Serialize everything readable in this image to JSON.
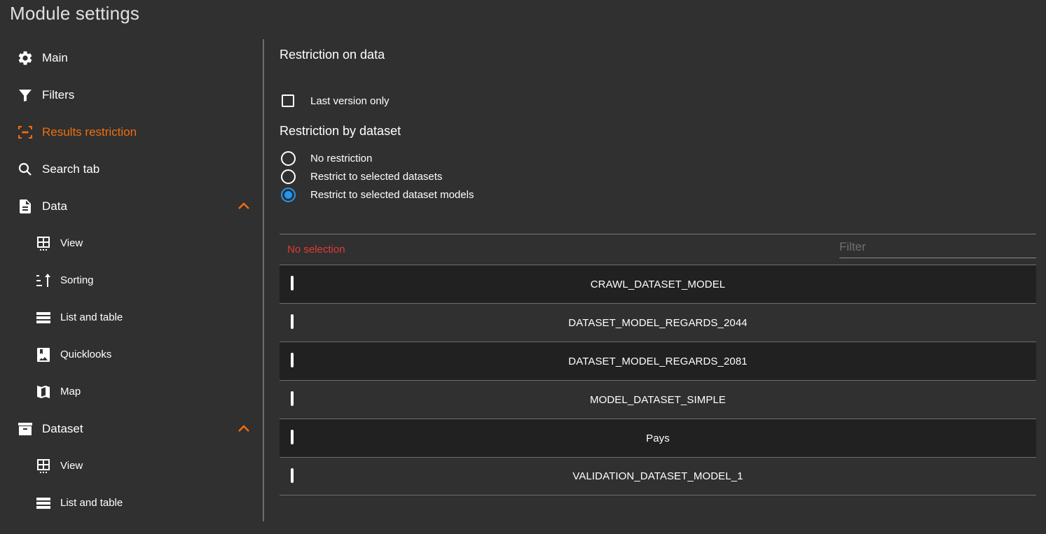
{
  "page": {
    "title": "Module settings"
  },
  "colors": {
    "accent": "#f06e0f",
    "radio_selected": "#2196f3",
    "error": "#e53935"
  },
  "sidebar": {
    "items": [
      {
        "label": "Main",
        "icon": "gear-icon",
        "active": false
      },
      {
        "label": "Filters",
        "icon": "filter-icon",
        "active": false
      },
      {
        "label": "Results restriction",
        "icon": "select-area-icon",
        "active": true
      },
      {
        "label": "Search tab",
        "icon": "search-icon",
        "active": false
      },
      {
        "label": "Data",
        "icon": "document-icon",
        "expanded": true,
        "children": [
          {
            "label": "View",
            "icon": "grid-view-icon"
          },
          {
            "label": "Sorting",
            "icon": "sort-ascending-icon"
          },
          {
            "label": "List and table",
            "icon": "list-icon"
          },
          {
            "label": "Quicklooks",
            "icon": "image-bookmark-icon"
          },
          {
            "label": "Map",
            "icon": "map-icon"
          }
        ]
      },
      {
        "label": "Dataset",
        "icon": "archive-icon",
        "expanded": true,
        "children": [
          {
            "label": "View",
            "icon": "grid-view-icon"
          },
          {
            "label": "List and table",
            "icon": "list-icon"
          }
        ]
      }
    ]
  },
  "main": {
    "restriction_on_data": {
      "title": "Restriction on data",
      "last_version_only": {
        "label": "Last version only",
        "checked": false
      }
    },
    "restriction_by_dataset": {
      "title": "Restriction by dataset",
      "options": [
        {
          "label": "No restriction",
          "selected": false
        },
        {
          "label": "Restrict to selected datasets",
          "selected": false
        },
        {
          "label": "Restrict to selected dataset models",
          "selected": true
        }
      ]
    },
    "selection_list": {
      "status": "No selection",
      "filter": {
        "placeholder": "Filter",
        "value": ""
      },
      "rows": [
        {
          "label": "CRAWL_DATASET_MODEL",
          "checked": false
        },
        {
          "label": "DATASET_MODEL_REGARDS_2044",
          "checked": false
        },
        {
          "label": "DATASET_MODEL_REGARDS_2081",
          "checked": false
        },
        {
          "label": "MODEL_DATASET_SIMPLE",
          "checked": false
        },
        {
          "label": "Pays",
          "checked": false
        },
        {
          "label": "VALIDATION_DATASET_MODEL_1",
          "checked": false
        }
      ]
    }
  }
}
